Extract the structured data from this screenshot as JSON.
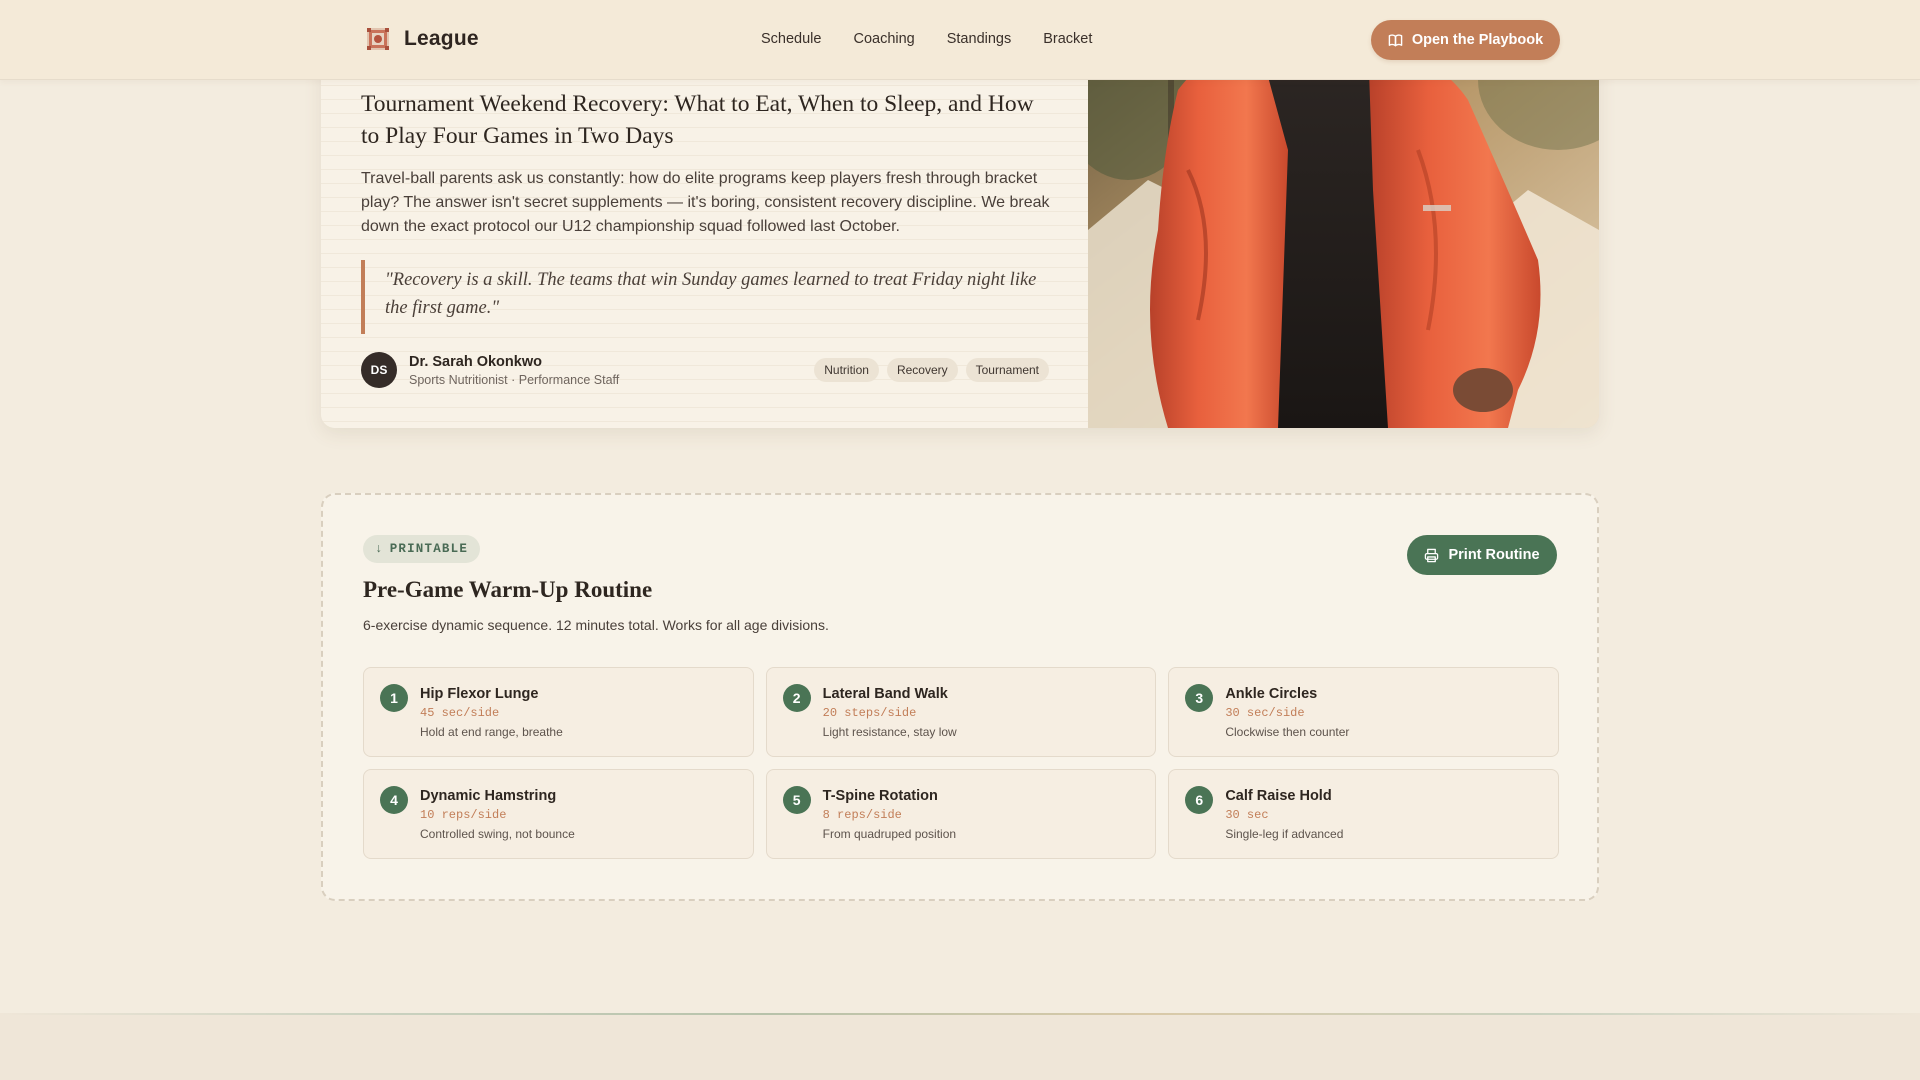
{
  "header": {
    "brand": "League",
    "nav": [
      "Schedule",
      "Coaching",
      "Standings",
      "Bracket"
    ],
    "cta_label": "Open the Playbook",
    "cta_icon": "book-icon"
  },
  "article": {
    "title": "Tournament Weekend Recovery: What to Eat, When to Sleep, and How to Play Four Games in Two Days",
    "lead": "Travel-ball parents ask us constantly: how do elite programs keep players fresh through bracket play? The answer isn't secret supplements — it's boring, consistent recovery discipline. We break down the exact protocol our U12 championship squad followed last October.",
    "quote": "\"Recovery is a skill. The teams that win Sunday games learned to treat Friday night like the first game.\"",
    "author": {
      "initials": "DS",
      "name": "Dr. Sarah Okonkwo",
      "role": "Sports Nutritionist · Performance Staff"
    },
    "tags": [
      "Nutrition",
      "Recovery",
      "Tournament"
    ]
  },
  "routine": {
    "badge": "PRINTABLE",
    "badge_icon": "↓",
    "print_label": "Print Routine",
    "print_icon": "printer-icon",
    "title": "Pre-Game Warm-Up Routine",
    "subtitle": "6-exercise dynamic sequence. 12 minutes total. Works for all age divisions.",
    "exercises": [
      {
        "num": "1",
        "name": "Hip Flexor Lunge",
        "dose": "45 sec/side",
        "note": "Hold at end range, breathe"
      },
      {
        "num": "2",
        "name": "Lateral Band Walk",
        "dose": "20 steps/side",
        "note": "Light resistance, stay low"
      },
      {
        "num": "3",
        "name": "Ankle Circles",
        "dose": "30 sec/side",
        "note": "Clockwise then counter"
      },
      {
        "num": "4",
        "name": "Dynamic Hamstring",
        "dose": "10 reps/side",
        "note": "Controlled swing, not bounce"
      },
      {
        "num": "5",
        "name": "T-Spine Rotation",
        "dose": "8 reps/side",
        "note": "From quadruped position"
      },
      {
        "num": "6",
        "name": "Calf Raise Hold",
        "dose": "30 sec",
        "note": "Single-leg if advanced"
      }
    ]
  },
  "colors": {
    "accent": "#c27e58",
    "green": "#4a7455",
    "background": "#f3ecdf"
  }
}
